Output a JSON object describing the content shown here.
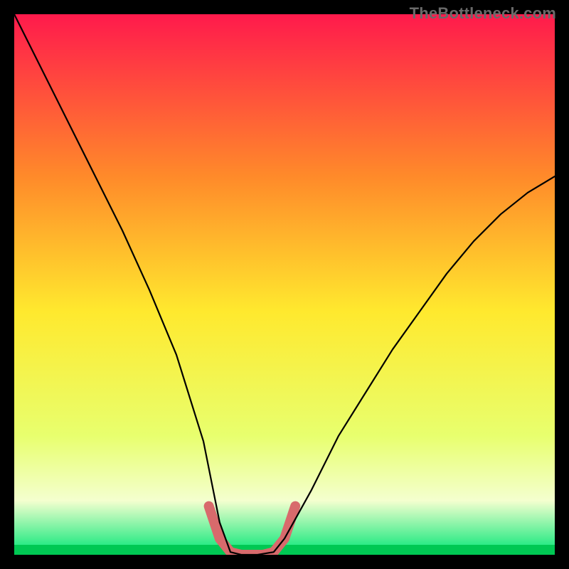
{
  "watermark": "TheBottleneck.com",
  "chart_data": {
    "type": "line",
    "title": "",
    "xlabel": "",
    "ylabel": "",
    "xlim": [
      0,
      100
    ],
    "ylim": [
      0,
      100
    ],
    "series": [
      {
        "name": "bottleneck-curve",
        "x": [
          0,
          5,
          10,
          15,
          20,
          25,
          30,
          35,
          38,
          40,
          42,
          45,
          48,
          50,
          55,
          60,
          65,
          70,
          75,
          80,
          85,
          90,
          95,
          100
        ],
        "values": [
          100,
          90,
          80,
          70,
          60,
          49,
          37,
          21,
          6,
          0.5,
          0,
          0,
          0.5,
          3,
          12,
          22,
          30,
          38,
          45,
          52,
          58,
          63,
          67,
          70
        ]
      },
      {
        "name": "optimal-region-highlight",
        "x": [
          36,
          38,
          40,
          42,
          44,
          46,
          48,
          50,
          52
        ],
        "values": [
          9,
          3,
          0.5,
          0,
          0,
          0,
          0.5,
          3,
          9
        ]
      }
    ],
    "gradient_colors": {
      "top": "#ff1a4c",
      "upper_mid": "#ff8a2a",
      "mid": "#ffe92e",
      "lower_mid": "#e8ff6e",
      "band": "#f4ffcf",
      "bottom": "#00e676"
    },
    "highlight_color": "#d86a6c",
    "curve_color": "#000000"
  }
}
